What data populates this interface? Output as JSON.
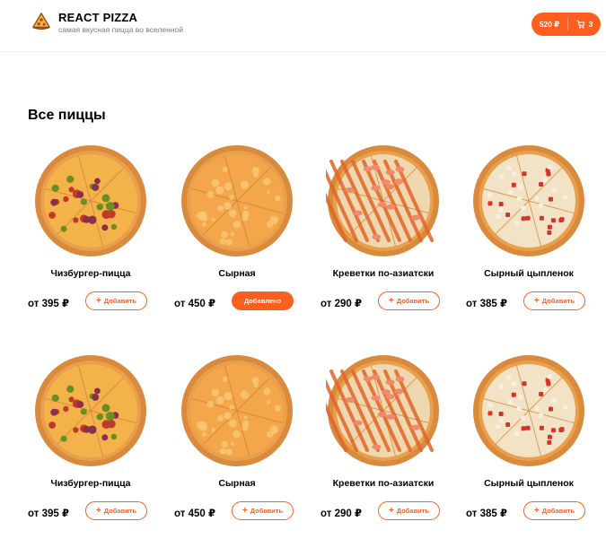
{
  "header": {
    "title": "REACT PIZZA",
    "subtitle": "самая вкусная пицца во вселенной",
    "cart_price": "520 ₽",
    "cart_count": "3"
  },
  "section_title": "Все пиццы",
  "pizzas": [
    {
      "name": "Чизбургер-пицца",
      "price": "от 395 ₽",
      "button": "Добавить",
      "added": false,
      "kind": "cheeseburger"
    },
    {
      "name": "Сырная",
      "price": "от 450 ₽",
      "button": "Добавлено",
      "added": true,
      "kind": "cheese"
    },
    {
      "name": "Креветки по-азиатски",
      "price": "от 290 ₽",
      "button": "Добавить",
      "added": false,
      "kind": "shrimp"
    },
    {
      "name": "Сырный цыпленок",
      "price": "от 385 ₽",
      "button": "Добавить",
      "added": false,
      "kind": "chicken"
    },
    {
      "name": "Чизбургер-пицца",
      "price": "от 395 ₽",
      "button": "Добавить",
      "added": false,
      "kind": "cheeseburger"
    },
    {
      "name": "Сырная",
      "price": "от 450 ₽",
      "button": "Добавить",
      "added": false,
      "kind": "cheese"
    },
    {
      "name": "Креветки по-азиатски",
      "price": "от 290 ₽",
      "button": "Добавить",
      "added": false,
      "kind": "shrimp"
    },
    {
      "name": "Сырный цыпленок",
      "price": "от 385 ₽",
      "button": "Добавить",
      "added": false,
      "kind": "chicken"
    }
  ],
  "colors": {
    "accent": "#fe5f1e",
    "crust": "#d98a3c",
    "cheese": "#f4b24a"
  }
}
